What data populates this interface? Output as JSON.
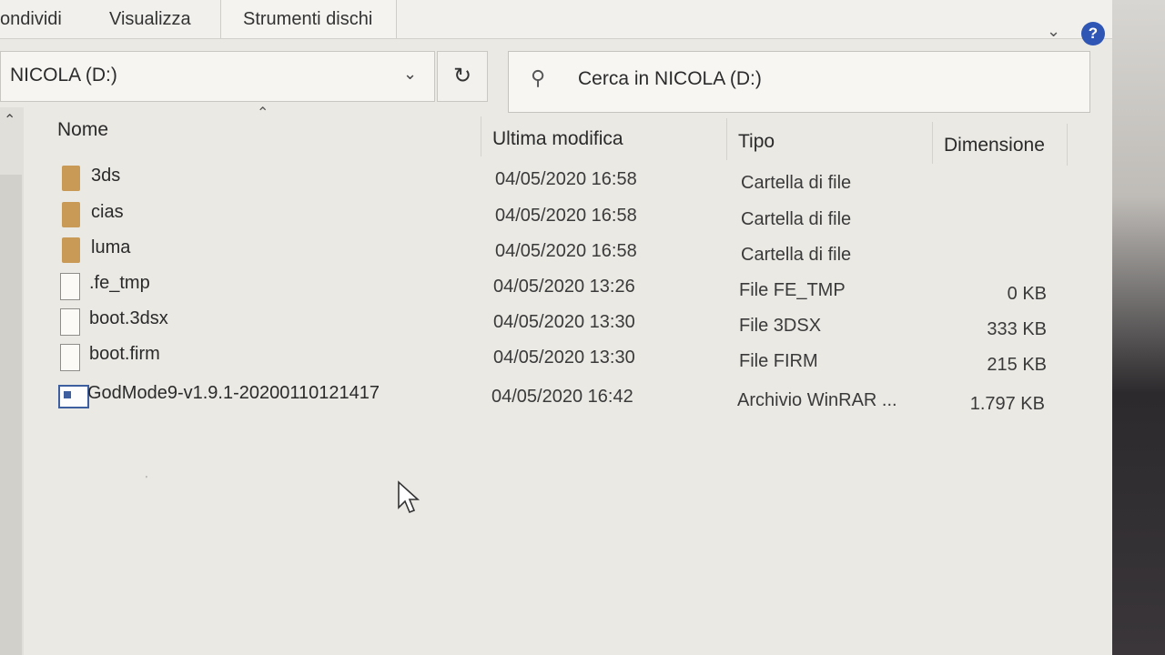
{
  "ribbon": {
    "tabs": [
      "ondividi",
      "Visualizza",
      "Strumenti dischi"
    ],
    "help_label": "?"
  },
  "address": {
    "path": "NICOLA (D:)",
    "refresh_glyph": "↻"
  },
  "search": {
    "placeholder": "Cerca in NICOLA (D:)"
  },
  "columns": {
    "name": "Nome",
    "modified": "Ultima modifica",
    "type": "Tipo",
    "size": "Dimensione"
  },
  "files": [
    {
      "name": "3ds",
      "modified": "04/05/2020 16:58",
      "type": "Cartella di file",
      "size": "",
      "icon": "folder-icon"
    },
    {
      "name": "cias",
      "modified": "04/05/2020 16:58",
      "type": "Cartella di file",
      "size": "",
      "icon": "folder-icon"
    },
    {
      "name": "luma",
      "modified": "04/05/2020 16:58",
      "type": "Cartella di file",
      "size": "",
      "icon": "folder-icon"
    },
    {
      "name": ".fe_tmp",
      "modified": "04/05/2020 13:26",
      "type": "File FE_TMP",
      "size": "0 KB",
      "icon": "file-icon"
    },
    {
      "name": "boot.3dsx",
      "modified": "04/05/2020 13:30",
      "type": "File 3DSX",
      "size": "333 KB",
      "icon": "file-icon"
    },
    {
      "name": "boot.firm",
      "modified": "04/05/2020 13:30",
      "type": "File FIRM",
      "size": "215 KB",
      "icon": "file-icon"
    },
    {
      "name": "GodMode9-v1.9.1-20200110121417",
      "modified": "04/05/2020 16:42",
      "type": "Archivio WinRAR ...",
      "size": "1.797 KB",
      "icon": "winrar-archive-icon"
    }
  ]
}
